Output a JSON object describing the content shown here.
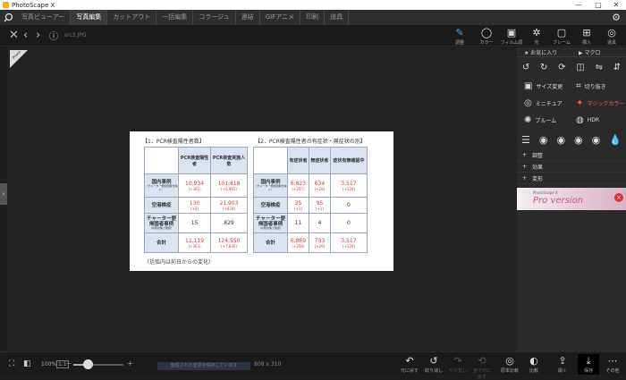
{
  "titlebar": {
    "title": "PhotoScape X",
    "minimize": "—",
    "maximize": "□",
    "close": "✕"
  },
  "menubar": {
    "tabs": [
      "写真ビューアー",
      "写真編集",
      "カットアウト",
      "一括編集",
      "コラージュ",
      "連結",
      "GIFアニメ",
      "印刷",
      "道具"
    ],
    "active_index": 1
  },
  "topbar": {
    "filename": "src3.JPG",
    "tools": [
      {
        "label": "調整",
        "icon": "adjust-icon"
      },
      {
        "label": "カラー",
        "icon": "color-icon"
      },
      {
        "label": "フィルム調",
        "icon": "film-icon"
      },
      {
        "label": "光",
        "icon": "light-icon"
      },
      {
        "label": "フレーム",
        "icon": "frame-icon"
      },
      {
        "label": "挿入",
        "icon": "insert-icon"
      },
      {
        "label": "道具",
        "icon": "tools-icon"
      }
    ]
  },
  "badge": "Photo",
  "document": {
    "heading_left": "【1．PCR検査陽性者数】",
    "heading_right": "【2．PCR検査陽性者の有症状・無症状の別】",
    "note": "（括弧内は前日からの変化）",
    "table1": {
      "headers": [
        "PCR検査陽性者",
        "PCR検査実施人数"
      ],
      "rows": [
        {
          "label": "国内事例",
          "sub": "（チャーター便帰国者を除く）",
          "c1": "10,934",
          "c1d": "(+361)",
          "c2": "101,818",
          "c2d": "(+6,992)"
        },
        {
          "label": "空港検疫",
          "sub": "",
          "c1": "130",
          "c1d": "(+2)",
          "c2": "21,903",
          "c2d": "(+834)"
        },
        {
          "label": "チャーター便帰国者事例",
          "sub": "（水際対策で確認）",
          "c1": "15",
          "c1d": "",
          "c2": "829",
          "c2d": ""
        },
        {
          "label": "合計",
          "sub": "",
          "c1": "11,119",
          "c1d": "(+363)",
          "c2": "124,550",
          "c2d": "(+7,836)"
        }
      ]
    },
    "table2": {
      "headers": [
        "有症状者",
        "無症状者",
        "症状有無確認中"
      ],
      "rows": [
        {
          "label": "国内事例",
          "sub": "（チャーター便帰国者を除く）",
          "c1": "6,823",
          "c1d": "(+207)",
          "c2": "634",
          "c2d": "(+28)",
          "c3": "3,517",
          "c3d": "(+126)"
        },
        {
          "label": "空港検疫",
          "sub": "",
          "c1": "35",
          "c1d": "(+1)",
          "c2": "95",
          "c2d": "(+1)",
          "c3": "0",
          "c3d": ""
        },
        {
          "label": "チャーター便帰国者事例",
          "sub": "（水際対策で確認）",
          "c1": "11",
          "c1d": "",
          "c2": "4",
          "c2d": "",
          "c3": "0",
          "c3d": ""
        },
        {
          "label": "合計",
          "sub": "",
          "c1": "6,869",
          "c1d": "(+208)",
          "c2": "733",
          "c2d": "(+29)",
          "c3": "3,517",
          "c3d": "(+126)"
        }
      ]
    }
  },
  "right_panel": {
    "tabs": [
      "お気に入り",
      "マクロ"
    ],
    "items": [
      {
        "label": "サイズ変更",
        "icon": "resize-icon"
      },
      {
        "label": "切り抜き",
        "icon": "crop-icon"
      },
      {
        "label": "ミニチュア",
        "icon": "miniature-icon"
      },
      {
        "label": "マジックカラー",
        "icon": "magic-color-icon"
      },
      {
        "label": "ブルーム",
        "icon": "bloom-icon"
      },
      {
        "label": "HDR",
        "icon": "hdr-icon"
      }
    ],
    "sections": [
      "調整",
      "効果",
      "変形"
    ],
    "promo": {
      "small": "PhotoScape X",
      "big": "Pro version"
    }
  },
  "bottombar": {
    "zoom": "100%",
    "ratio": "1:1",
    "minus": "—",
    "plus": "+",
    "status": "整理された変更を保存しています",
    "size": "808 x 310",
    "tools": [
      {
        "label": "元に戻す",
        "icon": "undo-icon"
      },
      {
        "label": "取り消し",
        "icon": "revert-icon"
      },
      {
        "label": "やり直し",
        "icon": "redo-icon"
      },
      {
        "label": "全て元に戻す",
        "icon": "undo-all-icon"
      },
      {
        "label": "原本比較",
        "icon": "compare-icon"
      },
      {
        "label": "比較",
        "icon": "compare-split-icon"
      },
      {
        "label": "開く",
        "icon": "open-icon"
      },
      {
        "label": "保存",
        "icon": "save-icon"
      },
      {
        "label": "その他",
        "icon": "more-icon"
      }
    ]
  }
}
